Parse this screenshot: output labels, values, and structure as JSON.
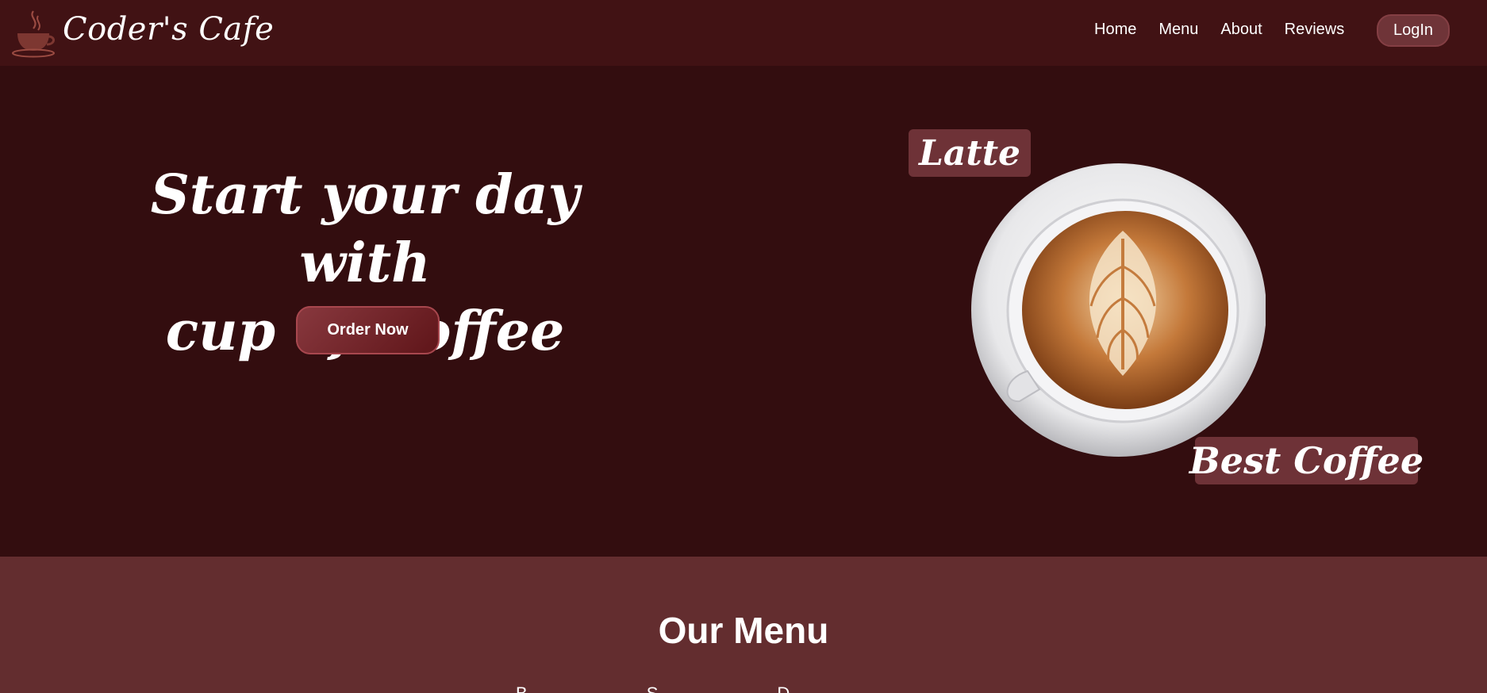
{
  "brand": {
    "name": "Coder's Cafe",
    "logo_icon": "coffee-cup-icon"
  },
  "nav": {
    "links": [
      "Home",
      "Menu",
      "About",
      "Reviews"
    ],
    "login_label": "LogIn"
  },
  "hero": {
    "title_line1": "Start your day with",
    "title_line2": "cup of Coffee",
    "order_button": "Order Now",
    "tag_latte": "Latte",
    "tag_best": "Best Coffee",
    "image": "latte-art-cup"
  },
  "menu": {
    "title": "Our Menu",
    "tabs": [
      "B",
      "S",
      "D"
    ]
  },
  "colors": {
    "nav_bg": "#411214",
    "hero_bg": "#330d0f",
    "menu_bg": "#632d2f",
    "accent": "#6e3237"
  }
}
